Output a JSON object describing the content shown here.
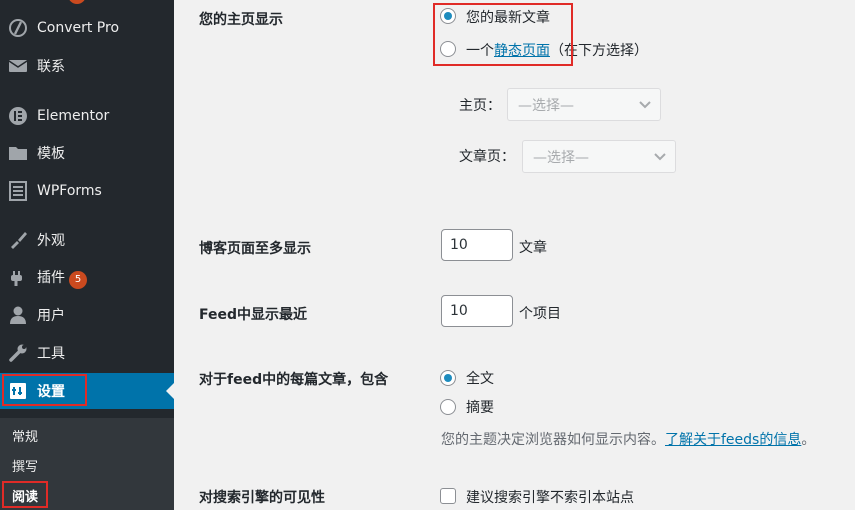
{
  "sidebar": {
    "items": [
      {
        "label": "Convert Pro",
        "icon": "convert-pro-icon"
      },
      {
        "label": "联系",
        "icon": "envelope-icon"
      },
      {
        "label": "Elementor",
        "icon": "elementor-icon"
      },
      {
        "label": "模板",
        "icon": "folder-icon"
      },
      {
        "label": "WPForms",
        "icon": "wpforms-icon"
      },
      {
        "label": "外观",
        "icon": "paintbrush-icon"
      },
      {
        "label": "插件",
        "icon": "plugin-icon",
        "badge": "5"
      },
      {
        "label": "用户",
        "icon": "user-icon"
      },
      {
        "label": "工具",
        "icon": "wrench-icon"
      },
      {
        "label": "设置",
        "icon": "settings-icon"
      }
    ],
    "submenu": [
      "常规",
      "撰写",
      "阅读"
    ]
  },
  "settings": {
    "front_page": {
      "label": "您的主页显示",
      "option_latest": "您的最新文章",
      "option_static_prefix": "一个",
      "option_static_link": "静态页面",
      "option_static_suffix": "（在下方选择）",
      "homepage_label": "主页：",
      "homepage_value": "—选择—",
      "postspage_label": "文章页：",
      "postspage_value": "—选择—"
    },
    "posts_per_page": {
      "label": "博客页面至多显示",
      "value": "10",
      "unit": "文章"
    },
    "feed_items": {
      "label": "Feed中显示最近",
      "value": "10",
      "unit": "个项目"
    },
    "feed_content": {
      "label": "对于feed中的每篇文章，包含",
      "option_full": "全文",
      "option_summary": "摘要",
      "desc": "您的主题决定浏览器如何显示内容。",
      "desc_link": "了解关于feeds的信息",
      "desc_end": "。"
    },
    "search_visibility": {
      "label": "对搜索引擎的可见性",
      "checkbox_label": "建议搜索引擎不索引本站点"
    }
  },
  "colors": {
    "accent": "#0073aa",
    "highlight": "#e02b27",
    "sidebar": "#23282d"
  }
}
